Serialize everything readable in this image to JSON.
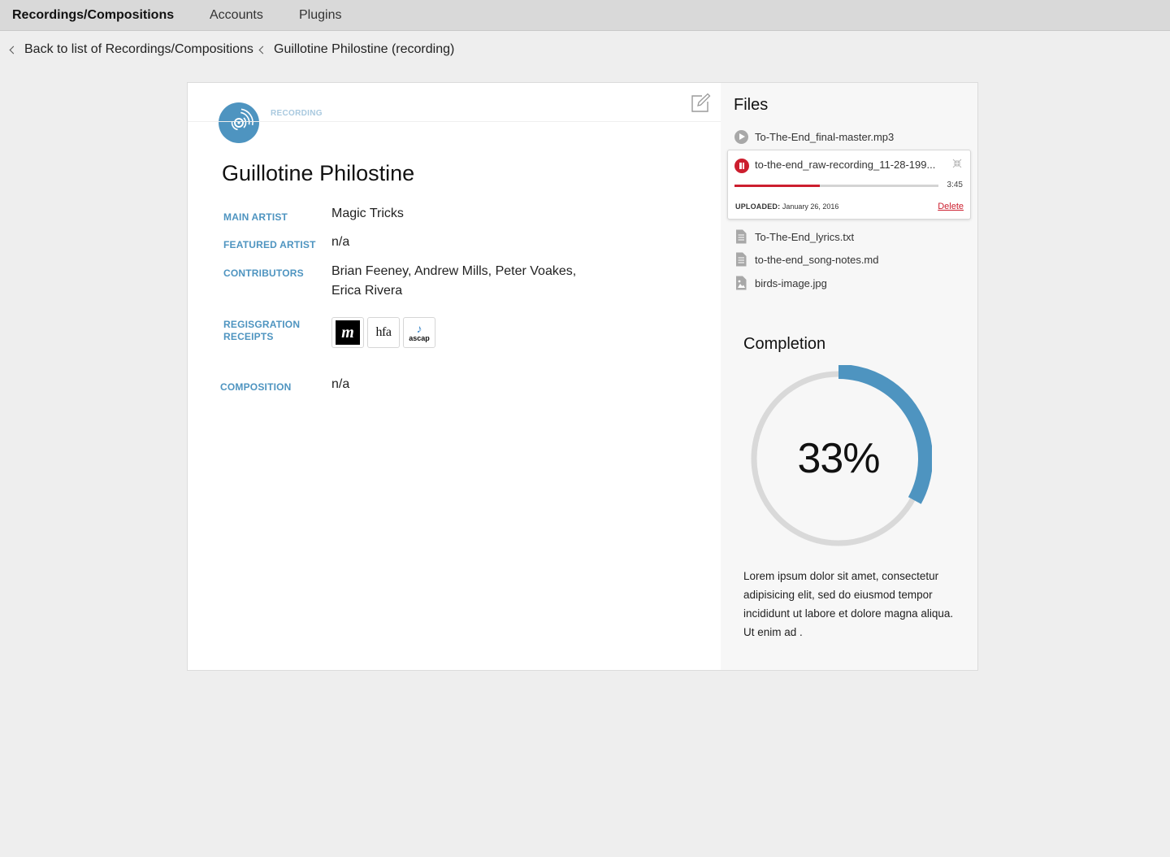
{
  "nav": {
    "items": [
      {
        "label": "Recordings/Compositions",
        "active": true
      },
      {
        "label": "Accounts",
        "active": false
      },
      {
        "label": "Plugins",
        "active": false
      }
    ]
  },
  "breadcrumb": {
    "back": "Back to list of Recordings/Compositions",
    "current": "Guillotine Philostine (recording)"
  },
  "record": {
    "type_label": "RECORDING",
    "icon": "vinyl-disc-icon",
    "title": "Guillotine Philostine",
    "fields": {
      "main_artist": {
        "label": "MAIN ARTIST",
        "value": "Magic Tricks"
      },
      "featured_artist": {
        "label": "FEATURED ARTIST",
        "value": "n/a"
      },
      "contributors": {
        "label": "CONTRIBUTORS",
        "value_line1": "Brian Feeney, Andrew Mills, Peter Voakes,",
        "value_line2": "Erica Rivera"
      },
      "receipts": {
        "label_line1": "REGISGRATION",
        "label_line2": "RECEIPTS"
      },
      "composition": {
        "label": "COMPOSITION",
        "value": "n/a"
      }
    },
    "receipts": [
      {
        "name": "m",
        "icon": "m-logo"
      },
      {
        "name": "hfa",
        "icon": "hfa-logo"
      },
      {
        "name": "ascap",
        "icon": "ascap-logo",
        "note": "♪"
      }
    ]
  },
  "files": {
    "title": "Files",
    "items": [
      {
        "name": "To-The-End_final-master.mp3",
        "icon": "play-icon"
      },
      {
        "name": "To-The-End_lyrics.txt",
        "icon": "document-icon"
      },
      {
        "name": "to-the-end_song-notes.md",
        "icon": "document-icon"
      },
      {
        "name": "birds-image.jpg",
        "icon": "image-file-icon"
      }
    ],
    "player": {
      "name": "to-the-end_raw-recording_11-28-199...",
      "duration": "3:45",
      "progress": 0.42,
      "uploaded_label": "UPLOADED:",
      "uploaded_date": "January 26, 2016",
      "delete_label": "Delete",
      "accent": "#cc1e2e"
    }
  },
  "completion": {
    "title": "Completion",
    "percent": 33,
    "percent_label": "33%",
    "accent": "#4e94c0",
    "track_color": "#d9d9d9",
    "description": "Lorem ipsum dolor sit amet, consectetur adipisicing elit, sed do eiusmod tempor incididunt ut labore et dolore magna aliqua. Ut enim ad ."
  }
}
